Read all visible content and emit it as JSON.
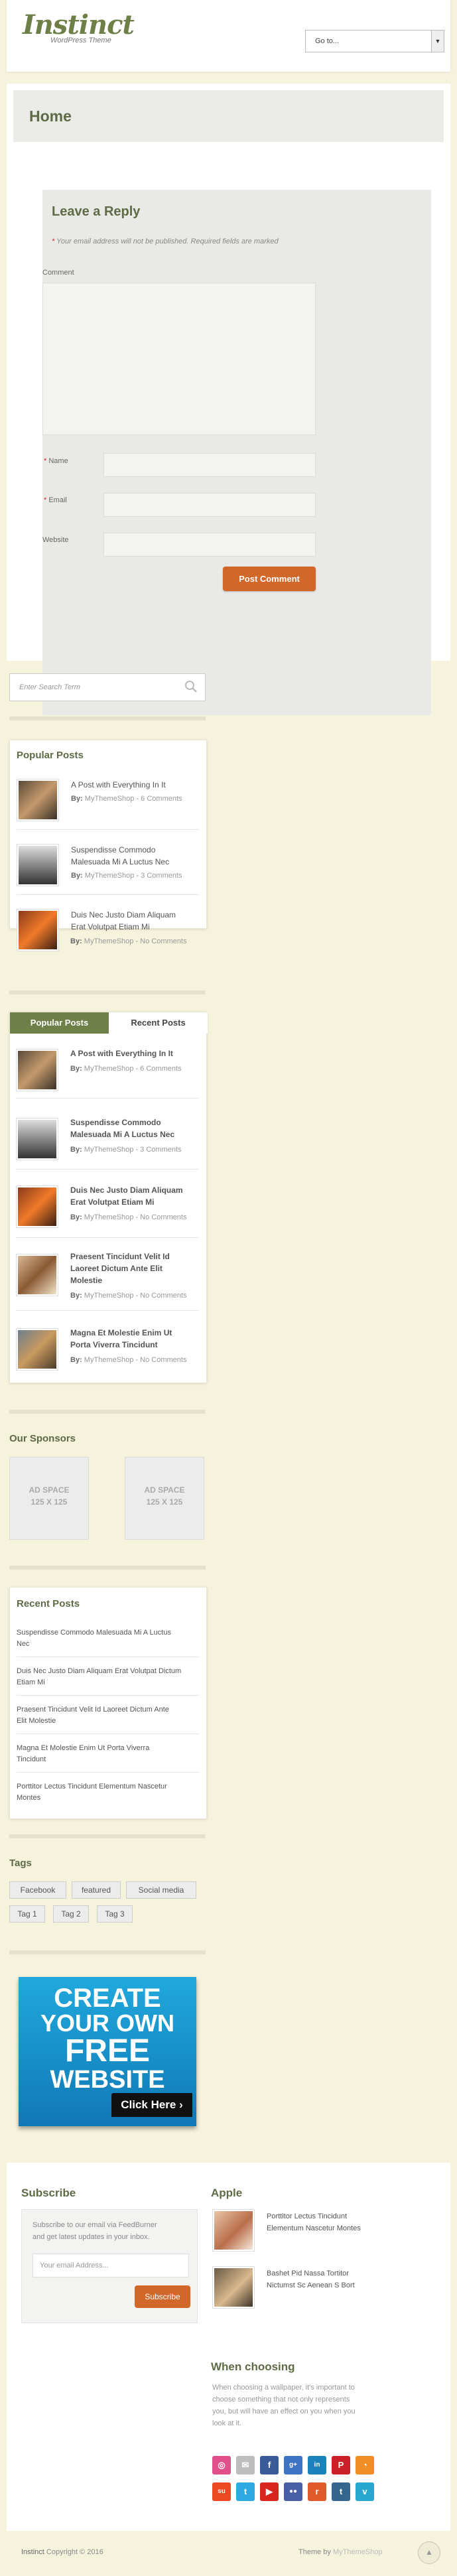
{
  "header": {
    "logo": "Instinct",
    "tagline": "WordPress Theme",
    "goto_label": "Go to...",
    "goto_arrow": "▼"
  },
  "page": {
    "title": "Home"
  },
  "reply": {
    "heading": "Leave a Reply",
    "note": "Your email address will not be published. Required fields are marked",
    "required_mark": "*",
    "comment_label": "Comment",
    "name_label": "Name",
    "email_label": "Email",
    "website_label": "Website",
    "submit_label": "Post Comment"
  },
  "search": {
    "placeholder": "Enter Search Term"
  },
  "popular": {
    "heading": "Popular Posts",
    "by": "By:",
    "posts": [
      {
        "title_1": "A Post with Everything In It",
        "title_2": "",
        "author": "MyThemeShop",
        "comments": "- 6 Comments"
      },
      {
        "title_1": "Suspendisse Commodo",
        "title_2": "Malesuada Mi A Luctus Nec",
        "author": "MyThemeShop",
        "comments": "- 3 Comments"
      },
      {
        "title_1": "Duis Nec Justo Diam Aliquam",
        "title_2": "Erat Volutpat Etiam Mi",
        "author": "MyThemeShop",
        "comments": "- No Comments"
      }
    ]
  },
  "tabs": {
    "tab_popular": "Popular Posts",
    "tab_recent": "Recent Posts",
    "by": "By:",
    "posts": [
      {
        "title_1": "A Post with Everything In It",
        "title_2": "",
        "title_3": "",
        "author": "MyThemeShop",
        "comments": "- 6 Comments"
      },
      {
        "title_1": "Suspendisse Commodo",
        "title_2": "Malesuada Mi A Luctus Nec",
        "title_3": "",
        "author": "MyThemeShop",
        "comments": "- 3 Comments"
      },
      {
        "title_1": "Duis Nec Justo Diam Aliquam",
        "title_2": "Erat Volutpat Etiam Mi",
        "title_3": "",
        "author": "MyThemeShop",
        "comments": "- No Comments"
      },
      {
        "title_1": "Praesent Tincidunt Velit Id",
        "title_2": "Laoreet Dictum Ante Elit",
        "title_3": "Molestie",
        "author": "MyThemeShop",
        "comments": "- No Comments"
      },
      {
        "title_1": "Magna Et Molestie Enim Ut",
        "title_2": "Porta Viverra Tincidunt",
        "title_3": "",
        "author": "MyThemeShop",
        "comments": "- No Comments"
      }
    ]
  },
  "sponsors": {
    "heading": "Our Sponsors",
    "ad_1": "AD SPACE",
    "ad_size_1": "125 X 125",
    "ad_2": "AD SPACE",
    "ad_size_2": "125 X 125"
  },
  "recent": {
    "heading": "Recent Posts",
    "items": [
      {
        "l1": "Suspendisse Commodo Malesuada Mi A Luctus",
        "l2": "Nec"
      },
      {
        "l1": "Duis Nec Justo Diam Aliquam Erat Volutpat Dictum",
        "l2": "Etiam Mi"
      },
      {
        "l1": "Praesent Tincidunt Velit Id Laoreet Dictum Ante",
        "l2": "Elit Molestie"
      },
      {
        "l1": "Magna Et Molestie Enim Ut Porta Viverra",
        "l2": "Tincidunt"
      },
      {
        "l1": "Porttitor Lectus Tincidunt Elementum Nascetur",
        "l2": "Montes"
      }
    ]
  },
  "tags": {
    "heading": "Tags",
    "items": [
      "Facebook",
      "featured",
      "Social media",
      "Tag 1",
      "Tag 2",
      "Tag 3"
    ]
  },
  "cta": {
    "line_1": "CREATE",
    "line_2": "YOUR OWN",
    "line_3": "FREE",
    "line_4": "WEBSITE",
    "button": "Click Here ›"
  },
  "footer": {
    "subscribe_heading": "Subscribe",
    "subscribe_text_1": "Subscribe to our email via FeedBurner",
    "subscribe_text_2": "and get latest updates in your inbox.",
    "email_placeholder": "Your email Address...",
    "subscribe_button": "Subscribe",
    "apple_heading": "Apple",
    "apple_posts": [
      {
        "l1": "Porttitor Lectus Tincidunt",
        "l2": "Elementum Nascetur Montes"
      },
      {
        "l1": "Bashet Pid Nassa Tortitor",
        "l2": "Nictumst Sc Aenean S Bort"
      }
    ],
    "choosing_heading": "When choosing",
    "choosing_text": [
      "When choosing a wallpaper, it's important to",
      "choose something that not only represents",
      "you, but will have an effect on you when you",
      "look at it."
    ],
    "copyright_site": "Instinct",
    "copyright": "Copyright © 2016",
    "theme_by": "Theme by",
    "theme_link": "MyThemeShop"
  },
  "social_icons": [
    {
      "name": "dribbble-icon",
      "color": "#e2508b",
      "glyph": "◎"
    },
    {
      "name": "email-icon",
      "color": "#bdbdbd",
      "glyph": "✉"
    },
    {
      "name": "facebook-icon",
      "color": "#3b5b98",
      "glyph": "f"
    },
    {
      "name": "google-plus-icon",
      "color": "#3e72c2",
      "glyph": "g+"
    },
    {
      "name": "linkedin-icon",
      "color": "#1a83bc",
      "glyph": "in"
    },
    {
      "name": "pinterest-icon",
      "color": "#cb2027",
      "glyph": "P"
    },
    {
      "name": "rss-icon",
      "color": "#f08d25",
      "glyph": "◔"
    },
    {
      "name": "stumbleupon-icon",
      "color": "#eb4823",
      "glyph": "su"
    },
    {
      "name": "twitter-icon",
      "color": "#2fa9e1",
      "glyph": "t"
    },
    {
      "name": "youtube-icon",
      "color": "#d8261f",
      "glyph": "▶"
    },
    {
      "name": "flickr-icon",
      "color": "#4a5ea8",
      "glyph": "●●"
    },
    {
      "name": "reddit-icon",
      "color": "#e05a2c",
      "glyph": "r"
    },
    {
      "name": "tumblr-icon",
      "color": "#35668f",
      "glyph": "t"
    },
    {
      "name": "vimeo-icon",
      "color": "#28a8d0",
      "glyph": "v"
    }
  ]
}
